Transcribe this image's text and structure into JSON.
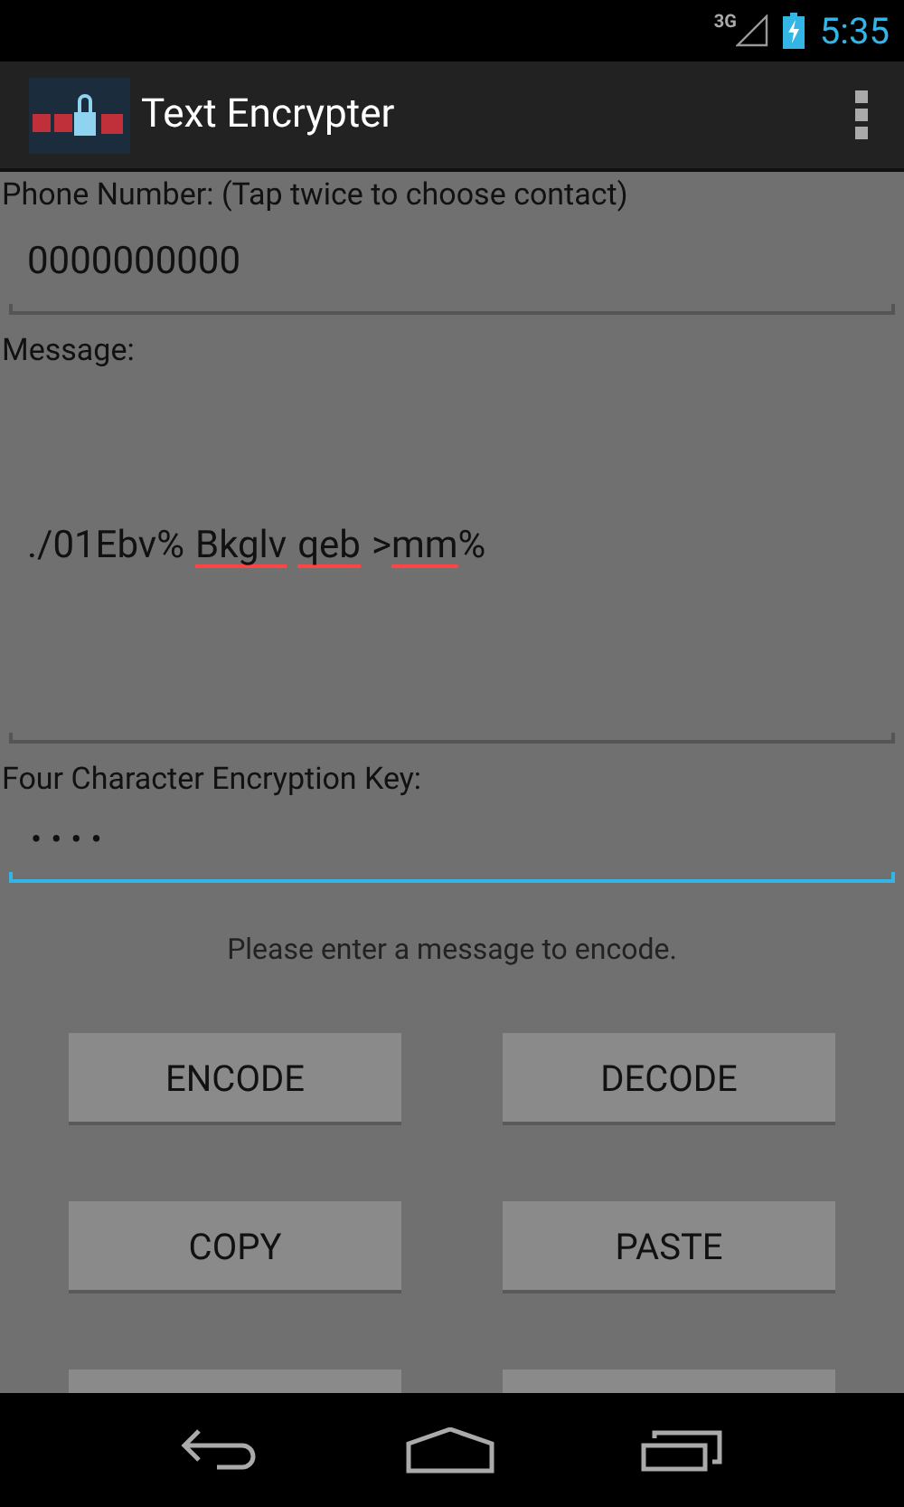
{
  "status_bar": {
    "network": "3G",
    "time": "5:35"
  },
  "action_bar": {
    "title": "Text Encrypter"
  },
  "phone": {
    "label": "Phone Number: (Tap twice to choose contact)",
    "value": "0000000000",
    "focused": false
  },
  "message": {
    "label": "Message:",
    "words": [
      {
        "text": "./01Ebv%",
        "misspelled": false,
        "space_after": true
      },
      {
        "text": "Bkglv",
        "misspelled": true,
        "space_after": true
      },
      {
        "text": "qeb",
        "misspelled": true,
        "space_after": true
      },
      {
        "text": ">",
        "misspelled": false,
        "space_after": false
      },
      {
        "text": "mm",
        "misspelled": true,
        "space_after": false
      },
      {
        "text": "%",
        "misspelled": false,
        "space_after": false
      }
    ],
    "focused": false
  },
  "key": {
    "label": "Four Character Encryption Key:",
    "value": "••••",
    "focused": true
  },
  "hint": "Please enter a message to encode.",
  "buttons": [
    {
      "kind": "full",
      "label": "ENCODE"
    },
    {
      "kind": "full",
      "label": "DECODE"
    },
    {
      "kind": "full",
      "label": "COPY"
    },
    {
      "kind": "full",
      "label": "PASTE"
    },
    {
      "kind": "cut_off"
    },
    {
      "kind": "cut_off"
    }
  ]
}
